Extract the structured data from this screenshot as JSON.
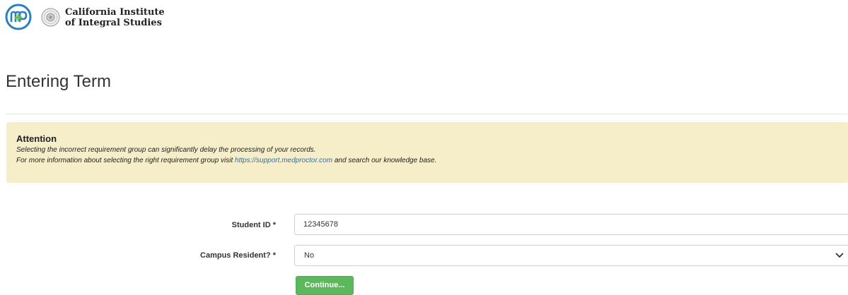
{
  "header": {
    "logo_icon": "medproctor-logo",
    "seal_icon": "institution-seal",
    "institution_name_line1": "California Institute",
    "institution_name_line2": "of Integral Studies"
  },
  "page": {
    "title": "Entering Term"
  },
  "alert": {
    "title": "Attention",
    "line1": "Selecting the incorrect requirement group can significantly delay the processing of your records.",
    "line2_prefix": "For more information about selecting the right requirement group visit ",
    "line2_link": "https://support.medproctor.com",
    "line2_suffix": " and search our knowledge base.",
    "background_color": "#f6eec8",
    "link_color": "#2f6fae"
  },
  "form": {
    "student_id_label": "Student ID *",
    "student_id_value": "12345678",
    "campus_resident_label": "Campus Resident? *",
    "campus_resident_value": "No",
    "continue_label": "Continue...",
    "button_color": "#5cb85c"
  }
}
